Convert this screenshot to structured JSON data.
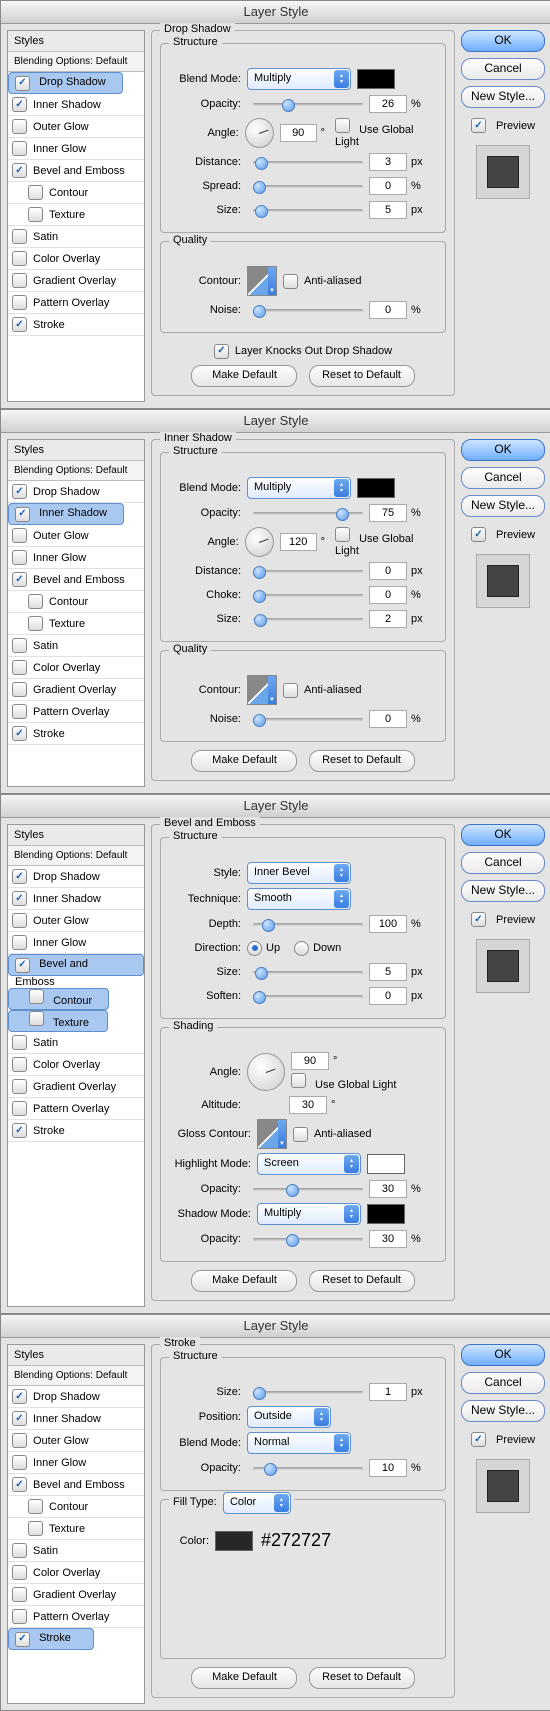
{
  "title": "Layer Style",
  "buttons": {
    "ok": "OK",
    "cancel": "Cancel",
    "newstyle": "New Style...",
    "preview": "Preview",
    "makedef": "Make Default",
    "reset": "Reset to Default"
  },
  "styles": {
    "head": "Styles",
    "blending": "Blending Options: Default",
    "list": [
      {
        "label": "Drop Shadow",
        "on": true
      },
      {
        "label": "Inner Shadow",
        "on": true
      },
      {
        "label": "Outer Glow",
        "on": false
      },
      {
        "label": "Inner Glow",
        "on": false
      },
      {
        "label": "Bevel and Emboss",
        "on": true
      },
      {
        "label": "Contour",
        "on": false,
        "sub": true
      },
      {
        "label": "Texture",
        "on": false,
        "sub": true
      },
      {
        "label": "Satin",
        "on": false
      },
      {
        "label": "Color Overlay",
        "on": false
      },
      {
        "label": "Gradient Overlay",
        "on": false
      },
      {
        "label": "Pattern Overlay",
        "on": false
      },
      {
        "label": "Stroke",
        "on": true
      }
    ]
  },
  "panels": [
    {
      "activeIdx": 0,
      "name": "Drop Shadow",
      "structure": {
        "legend": "Structure",
        "blendmode": {
          "label": "Blend Mode:",
          "value": "Multiply"
        },
        "opacity": {
          "label": "Opacity:",
          "value": "26",
          "unit": "%",
          "thumb": 26
        },
        "angle": {
          "label": "Angle:",
          "value": "90",
          "unit": "°",
          "global": "Use Global Light",
          "globalOn": false
        },
        "distance": {
          "label": "Distance:",
          "value": "3",
          "unit": "px",
          "thumb": 2
        },
        "spread": {
          "label": "Spread:",
          "value": "0",
          "unit": "%",
          "thumb": 0
        },
        "size": {
          "label": "Size:",
          "value": "5",
          "unit": "px",
          "thumb": 2
        }
      },
      "quality": {
        "legend": "Quality",
        "contour": {
          "label": "Contour:",
          "aa": "Anti-aliased",
          "aaOn": false
        },
        "noise": {
          "label": "Noise:",
          "value": "0",
          "unit": "%",
          "thumb": 0
        }
      },
      "knock": {
        "label": "Layer Knocks Out Drop Shadow",
        "on": true
      }
    },
    {
      "activeIdx": 1,
      "name": "Inner Shadow",
      "structure": {
        "legend": "Structure",
        "blendmode": {
          "label": "Blend Mode:",
          "value": "Multiply"
        },
        "opacity": {
          "label": "Opacity:",
          "value": "75",
          "unit": "%",
          "thumb": 75
        },
        "angle": {
          "label": "Angle:",
          "value": "120",
          "unit": "°",
          "global": "Use Global Light",
          "globalOn": false
        },
        "distance": {
          "label": "Distance:",
          "value": "0",
          "unit": "px",
          "thumb": 0
        },
        "spread": {
          "label": "Choke:",
          "value": "0",
          "unit": "%",
          "thumb": 0
        },
        "size": {
          "label": "Size:",
          "value": "2",
          "unit": "px",
          "thumb": 1
        }
      },
      "quality": {
        "legend": "Quality",
        "contour": {
          "label": "Contour:",
          "aa": "Anti-aliased",
          "aaOn": false
        },
        "noise": {
          "label": "Noise:",
          "value": "0",
          "unit": "%",
          "thumb": 0
        }
      }
    },
    {
      "activeIdx": 4,
      "subSel": [
        5,
        6
      ],
      "name": "Bevel and Emboss",
      "structure": {
        "legend": "Structure",
        "style": {
          "label": "Style:",
          "value": "Inner Bevel"
        },
        "technique": {
          "label": "Technique:",
          "value": "Smooth"
        },
        "depth": {
          "label": "Depth:",
          "value": "100",
          "unit": "%",
          "thumb": 8
        },
        "direction": {
          "label": "Direction:",
          "up": "Up",
          "down": "Down",
          "sel": "up"
        },
        "size": {
          "label": "Size:",
          "value": "5",
          "unit": "px",
          "thumb": 2
        },
        "soften": {
          "label": "Soften:",
          "value": "0",
          "unit": "px",
          "thumb": 0
        }
      },
      "shading": {
        "legend": "Shading",
        "angle": {
          "label": "Angle:",
          "value": "90",
          "unit": "°"
        },
        "global": {
          "label": "Use Global Light",
          "on": false
        },
        "altitude": {
          "label": "Altitude:",
          "value": "30",
          "unit": "°"
        },
        "gloss": {
          "label": "Gloss Contour:",
          "aa": "Anti-aliased",
          "aaOn": false
        },
        "hlmode": {
          "label": "Highlight Mode:",
          "value": "Screen"
        },
        "hlopacity": {
          "label": "Opacity:",
          "value": "30",
          "unit": "%",
          "thumb": 30
        },
        "shmode": {
          "label": "Shadow Mode:",
          "value": "Multiply"
        },
        "shopacity": {
          "label": "Opacity:",
          "value": "30",
          "unit": "%",
          "thumb": 30
        }
      }
    },
    {
      "activeIdx": 11,
      "name": "Stroke",
      "structure": {
        "legend": "Structure",
        "size": {
          "label": "Size:",
          "value": "1",
          "unit": "px",
          "thumb": 0
        },
        "position": {
          "label": "Position:",
          "value": "Outside"
        },
        "blendmode": {
          "label": "Blend Mode:",
          "value": "Normal"
        },
        "opacity": {
          "label": "Opacity:",
          "value": "10",
          "unit": "%",
          "thumb": 10
        }
      },
      "fill": {
        "legend": "Fill Type:",
        "value": "Color",
        "color": {
          "label": "Color:",
          "hex": "#272727"
        }
      }
    }
  ]
}
